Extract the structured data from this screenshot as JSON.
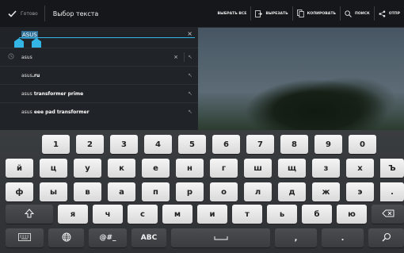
{
  "action_bar": {
    "done_label": "Готово",
    "title": "Выбор текста",
    "actions": [
      {
        "label": "ВЫБРАТЬ ВСЕ",
        "icon": "select-all-icon"
      },
      {
        "label": "ВЫРЕЗАТЬ",
        "icon": "cut-icon"
      },
      {
        "label": "КОПИРОВАТЬ",
        "icon": "copy-icon"
      },
      {
        "label": "ПОИСК",
        "icon": "search-icon"
      },
      {
        "label": "ОТПР",
        "icon": "share-icon"
      }
    ]
  },
  "search": {
    "query": "ASUS",
    "clear_glyph": "×"
  },
  "suggestions": [
    {
      "prefix": "asus",
      "rest": "",
      "history": true
    },
    {
      "prefix": "asus",
      "rest": ".ru",
      "history": false
    },
    {
      "prefix": "asus",
      "rest": " transformer prime",
      "history": false
    },
    {
      "prefix": "asus",
      "rest": " eee pad transformer",
      "history": false
    }
  ],
  "keyboard": {
    "row1": [
      "1",
      "2",
      "3",
      "4",
      "5",
      "6",
      "7",
      "8",
      "9",
      "0"
    ],
    "row2": [
      "й",
      "ц",
      "у",
      "к",
      "е",
      "н",
      "г",
      "ш",
      "щ",
      "з",
      "х",
      "Ъ"
    ],
    "row3": [
      "ф",
      "ы",
      "в",
      "а",
      "п",
      "р",
      "о",
      "л",
      "д",
      "ж",
      "э",
      "."
    ],
    "row4": [
      "я",
      "ч",
      "с",
      "м",
      "и",
      "т",
      "ь",
      "б",
      "ю"
    ],
    "row5": {
      "symbols": "@#_",
      "abc": "ABC",
      "comma": ",",
      "period": "."
    },
    "colors": {
      "key_light": "#e6e6e6",
      "key_dark": "#43464a",
      "accent": "#33b5e5"
    }
  }
}
